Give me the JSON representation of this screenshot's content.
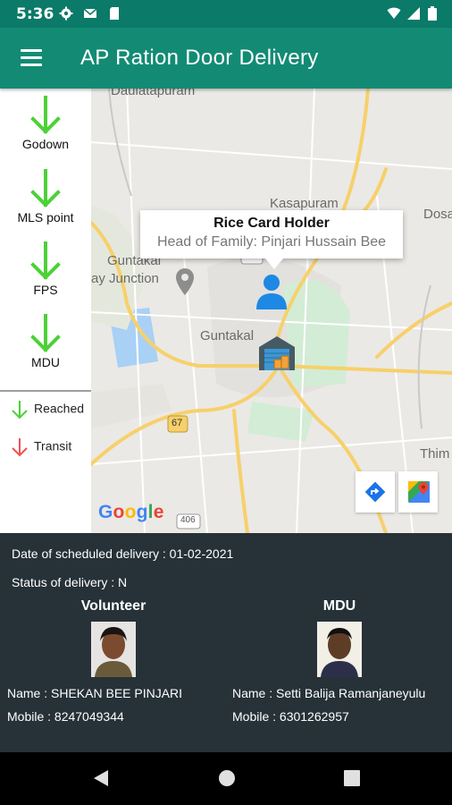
{
  "status_bar": {
    "time": "5:36",
    "left_icons": [
      "gear-icon",
      "gmail-icon",
      "sd-card-icon"
    ],
    "right_icons": [
      "wifi-icon",
      "signal-icon",
      "battery-icon"
    ]
  },
  "app_bar": {
    "title": "AP Ration Door Delivery",
    "menu_icon": "hamburger-menu-icon"
  },
  "legend": {
    "steps": [
      "Godown",
      "MLS point",
      "FPS",
      "MDU"
    ],
    "keys": [
      {
        "label": "Reached",
        "color": "#4cd137"
      },
      {
        "label": "Transit",
        "color": "#ef5350"
      }
    ]
  },
  "map": {
    "labels": {
      "daulatapuram": "Daulatapuram",
      "kasapuram": "Kasapuram",
      "dosa": "Dosa",
      "guntakal_junction_1": "Guntakal",
      "guntakal_junction_2": "ay Junction",
      "guntakal": "Guntakal",
      "thim": "Thim",
      "road_480": "480",
      "road_67": "67",
      "road_406": "406"
    },
    "info_window": {
      "title": "Rice Card Holder",
      "subtitle": "Head of Family: Pinjari Hussain Bee"
    },
    "google_logo": [
      "G",
      "o",
      "o",
      "g",
      "l",
      "e"
    ],
    "google_colors": [
      "#4285f4",
      "#ea4335",
      "#fbbc05",
      "#4285f4",
      "#34a853",
      "#ea4335"
    ]
  },
  "delivery": {
    "scheduled": "Date of scheduled delivery : 01-02-2021",
    "status": "Status of delivery : N",
    "volunteer": {
      "title": "Volunteer",
      "name": "Name : SHEKAN BEE PINJARI",
      "mobile": "Mobile : 8247049344"
    },
    "mdu": {
      "title": "MDU",
      "name": "Name : Setti Balija Ramanjaneyulu",
      "mobile": "Mobile : 6301262957"
    }
  },
  "colors": {
    "status_bar": "#0b7a68",
    "app_bar": "#138b74",
    "details_bg": "#263238",
    "arrow_green": "#4cd137",
    "arrow_red": "#ef5350"
  }
}
